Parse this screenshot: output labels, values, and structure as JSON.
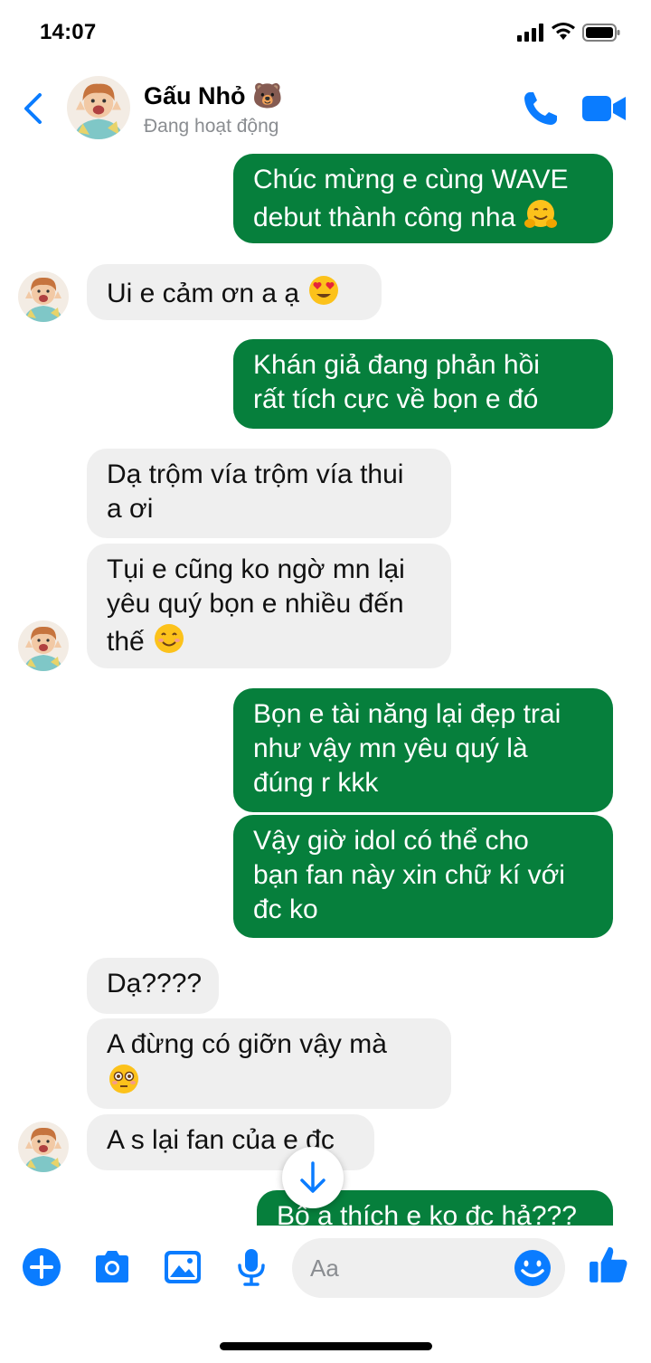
{
  "status_bar": {
    "time": "14:07"
  },
  "header": {
    "contact_name": "Gấu Nhỏ 🐻",
    "contact_status": "Đang hoạt động"
  },
  "messages": [
    {
      "sender": "me",
      "lines": [
        "Chúc mừng e cùng WAVE",
        "debut thành công nha"
      ],
      "emoji": "hugging-face"
    },
    {
      "sender": "contact",
      "lines": [
        "Ui e cảm ơn a ạ"
      ],
      "emoji": "heart-eyes"
    },
    {
      "sender": "me",
      "lines": [
        "Khán giả đang phản hồi",
        "rất tích cực về bọn e đó"
      ]
    },
    {
      "sender": "contact",
      "lines": [
        "Dạ trộm vía trộm vía thui",
        "a ơi"
      ]
    },
    {
      "sender": "contact",
      "lines": [
        "Tụi e cũng ko ngờ mn lại",
        "yêu quý bọn e nhiều đến",
        "thế"
      ],
      "emoji": "smiling-face"
    },
    {
      "sender": "me",
      "lines": [
        "Bọn e tài năng lại đẹp trai",
        "như vậy mn yêu quý là",
        "đúng r kkk"
      ]
    },
    {
      "sender": "me",
      "lines": [
        "Vậy giờ idol có thể cho",
        "bạn fan này xin chữ kí với",
        "đc ko"
      ]
    },
    {
      "sender": "contact",
      "lines": [
        "Dạ????"
      ]
    },
    {
      "sender": "contact",
      "lines": [
        "A đừng có giỡn vậy mà"
      ],
      "emoji": "flushed-face"
    },
    {
      "sender": "contact",
      "lines": [
        "A s lại fan của e đc"
      ]
    },
    {
      "sender": "me",
      "lines": [
        "Bộ a thích e ko đc hả???"
      ]
    }
  ],
  "composer": {
    "placeholder": "Aa"
  },
  "colors": {
    "accent": "#0a7cff",
    "outgoing_bubble": "#067f3c",
    "incoming_bubble": "#efefef"
  },
  "icons": [
    "back-icon",
    "phone-icon",
    "video-icon",
    "plus-icon",
    "camera-icon",
    "photo-icon",
    "mic-icon",
    "emoji-icon",
    "like-icon",
    "arrow-down-icon"
  ]
}
